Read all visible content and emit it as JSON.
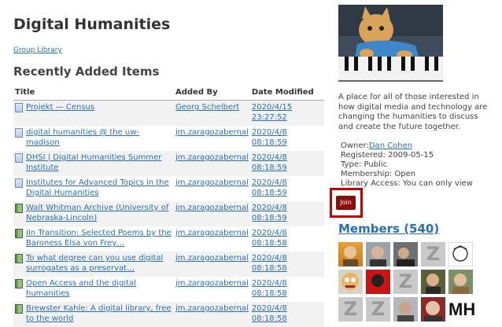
{
  "header": {
    "title": "Digital Humanities",
    "group_library": "Group Library"
  },
  "recent": {
    "heading": "Recently Added Items",
    "columns": {
      "title": "Title",
      "added_by": "Added By",
      "date": "Date Modified"
    },
    "rows": [
      {
        "type": "doc",
        "title": "Projekt — Census",
        "added_by": "Georg Schelbert",
        "date": "2020/4/15 23:27:52"
      },
      {
        "type": "doc",
        "title": "digital humanities @ the uw-madison",
        "added_by": "jm.zaragozabernal",
        "date": "2020/4/8 08:18:59"
      },
      {
        "type": "doc",
        "title": "DHSI | Digital Humanities Summer Institute",
        "added_by": "jm.zaragozabernal",
        "date": "2020/4/8 08:18:59"
      },
      {
        "type": "doc",
        "title": "Institutes for Advanced Topics in the Digital Humanities",
        "added_by": "jm.zaragozabernal",
        "date": "2020/4/8 08:18:59"
      },
      {
        "type": "book",
        "title": "Walt Whitman Archive (University of Nebraska-Lincoln)",
        "added_by": "jm.zaragozabernal",
        "date": "2020/4/8 08:18:59"
      },
      {
        "type": "book",
        "title": "IIn Transition: Selected Poems by the Baroness Elsa von Frey…",
        "added_by": "jm.zaragozabernal",
        "date": "2020/4/8 08:18:58"
      },
      {
        "type": "book",
        "title": "To what degree can you use digital surrogates as a preservat…",
        "added_by": "jm.zaragozabernal",
        "date": "2020/4/8 08:18:58"
      },
      {
        "type": "book",
        "title": "Open Access and the digital humanities",
        "added_by": "jm.zaragozabernal",
        "date": "2020/4/8 08:18:58"
      },
      {
        "type": "book",
        "title": "Brewster Kahle: A digital library, free to the world",
        "added_by": "jm.zaragozabernal",
        "date": "2020/4/8 08:18:58"
      }
    ]
  },
  "group": {
    "description": "A place for all of those interested in how digital media and technology are changing the humanities to discuss and create the future together.",
    "owner_label": "Owner:",
    "owner": "Dan Cohen",
    "registered": "Registered: 2009-05-15",
    "type": "Type: Public",
    "membership": "Membership: Open",
    "library_access": "Library Access: You can only view",
    "join_label": "Join",
    "members_title": "Members (540)",
    "avatar_letters": {
      "z": "Z",
      "mh": "MH"
    }
  },
  "colors": {
    "link": "#2a6fb5",
    "join_button": "#8c0c0c",
    "highlight": "#c40000"
  }
}
